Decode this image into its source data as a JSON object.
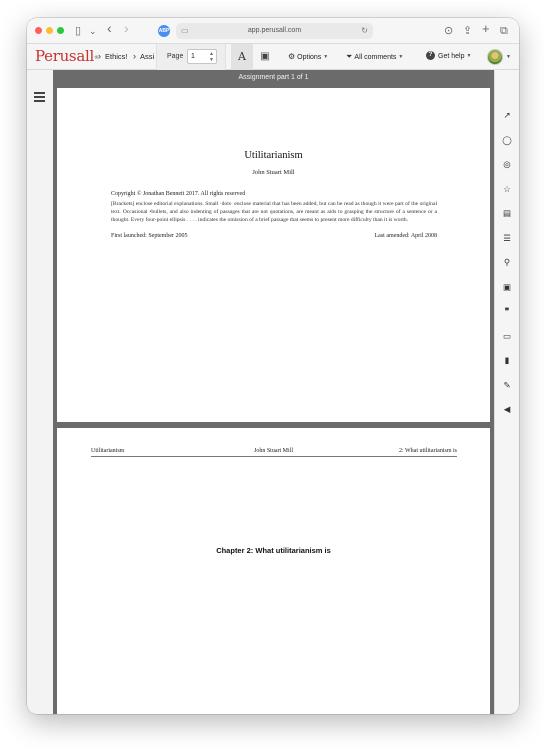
{
  "browser": {
    "url": "app.perusall.com",
    "abp_label": "ABP",
    "icons": {
      "sidebar": "▯",
      "chevron_down": "⌄",
      "back": "‹",
      "forward": "›",
      "page": "▭",
      "reload": "↻",
      "download": "⊙",
      "share": "⇪",
      "new_tab": "+",
      "tabs": "⧉"
    }
  },
  "toolbar": {
    "logo": "Perusall",
    "logo_mark": "®",
    "breadcrumb": [
      "Ethics!",
      "Assi"
    ],
    "page_label": "Page",
    "page_value": "1",
    "font_button": "A",
    "image_icon": "▣",
    "options_label": "Options",
    "all_comments_label": "All comments",
    "get_help_label": "Get help",
    "options_icon": "⚙",
    "filter_icon": "⏷",
    "help_icon": "?",
    "caret": "▼"
  },
  "viewer": {
    "header": "Assignment part 1 of 1",
    "page1": {
      "title": "Utilitarianism",
      "author": "John Stuart Mill",
      "copyright": "Copyright © Jonathan Bennett 2017. All rights reserved",
      "note": "[Brackets] enclose editorial explanations. Small ·dots· enclose material that has been added, but can be read as though it were part of the original text. Occasional •bullets, and also indenting of passages that are not quotations, are meant as aids to grasping the structure of a sentence or a thought. Every four-point ellipsis . . . . indicates the omission of a brief passage that seems to present more difficulty than it is worth.",
      "first_launched": "First launched: September 2005",
      "last_amended": "Last amended: April 2008"
    },
    "page2": {
      "running_head_left": "Utilitarianism",
      "running_head_center": "John Stuart Mill",
      "running_head_right": "2: What utilitarianism is",
      "chapter_heading": "Chapter 2: What utilitarianism is"
    }
  },
  "right_rail": {
    "icons": [
      "↗",
      "◯",
      "◎",
      "☆",
      "▤",
      "☰",
      "⚲",
      "▣",
      "❞",
      "▭",
      "▮",
      "✎",
      "◀"
    ]
  }
}
